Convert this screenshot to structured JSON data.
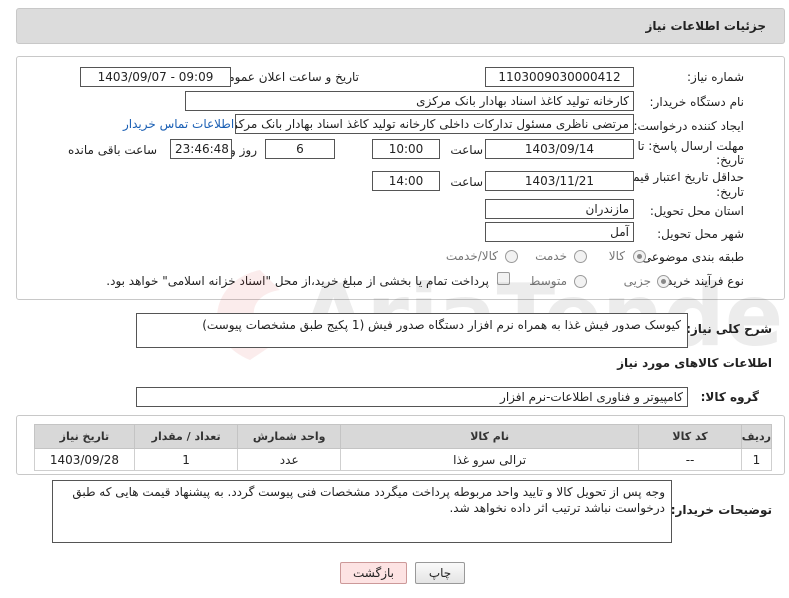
{
  "header": {
    "title": "جزئیات اطلاعات نیاز"
  },
  "form": {
    "need_number_label": "شماره نیاز:",
    "need_number": "1103009030000412",
    "announce_label": "تاریخ و ساعت اعلان عمومی:",
    "announce_value": "1403/09/07 - 09:09",
    "buyer_label": "نام دستگاه خریدار:",
    "buyer_value": "کارخانه تولید کاغذ اسناد بهادار بانک مرکزی",
    "creator_label": "ایجاد کننده درخواست:",
    "creator_value": "مرتضی ناظری مسئول تدارکات داخلی کارخانه تولید کاغذ اسناد بهادار بانک مرکزی",
    "contact_link": "اطلاعات تماس خریدار",
    "deadline_label_1": "مهلت ارسال پاسخ: تا",
    "deadline_label_2": "تاریخ:",
    "deadline_date": "1403/09/14",
    "time_label": "ساعت",
    "deadline_time": "10:00",
    "days_value": "6",
    "days_label": "روز و",
    "remaining_time": "23:46:48",
    "remaining_label": "ساعت باقی مانده",
    "validity_label_1": "حداقل تاریخ اعتبار قیمت: تا",
    "validity_label_2": "تاریخ:",
    "validity_date": "1403/11/21",
    "validity_time": "14:00",
    "province_label": "استان محل تحویل:",
    "province_value": "مازندران",
    "city_label": "شهر محل تحویل:",
    "city_value": "آمل",
    "category_label": "طبقه بندی موضوعی:",
    "category_options": [
      "کالا",
      "خدمت",
      "کالا/خدمت"
    ],
    "category_selected": "کالا",
    "process_label": "نوع فرآیند خرید :",
    "process_options": [
      "جزیی",
      "متوسط"
    ],
    "process_selected": "جزیی",
    "payment_note": "پرداخت تمام یا بخشی از مبلغ خرید،از محل \"اسناد خزانه اسلامی\" خواهد بود."
  },
  "description": {
    "label": "شرح کلی نیاز:",
    "value": "کیوسک صدور فیش غذا به همراه نرم افزار دستگاه صدور فیش (1 پکیج طبق مشخصات پیوست)"
  },
  "goods": {
    "section_title": "اطلاعات کالاهای مورد نیاز",
    "group_label": "گروه کالا:",
    "group_value": "کامپیوتر و فناوری اطلاعات-نرم افزار",
    "columns": [
      "ردیف",
      "کد کالا",
      "نام کالا",
      "واحد شمارش",
      "تعداد / مقدار",
      "تاریخ نیاز"
    ],
    "rows": [
      {
        "index": "1",
        "code": "--",
        "name": "ترالی سرو غذا",
        "unit": "عدد",
        "qty": "1",
        "date": "1403/09/28"
      }
    ]
  },
  "buyer_notes": {
    "label": "توضیحات خریدار:",
    "value": "وجه پس از تحویل کالا و تایید واحد مربوطه پرداخت میگردد مشخصات فنی پیوست گردد. به پیشنهاد قیمت هایی که طبق درخواست نباشد ترتیب اثر داده نخواهد شد."
  },
  "buttons": {
    "print": "چاپ",
    "back": "بازگشت"
  },
  "watermark_text": "AriaTender.net",
  "colors": {
    "header_bg": "#dcdcdc",
    "link": "#1a5fb4",
    "back_button_bg": "#fde3e3"
  }
}
